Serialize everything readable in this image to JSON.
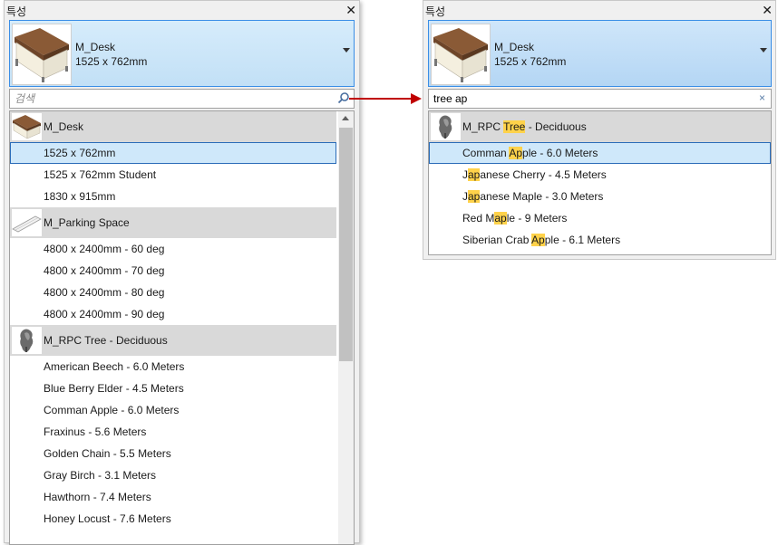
{
  "panel_title": "특성",
  "close_glyph": "✕",
  "left": {
    "type_selector": {
      "name": "M_Desk",
      "size": "1525 x 762mm"
    },
    "search": {
      "placeholder": "검색",
      "value": ""
    },
    "groups": [
      {
        "label": "M_Desk",
        "thumb": "desk",
        "items": [
          {
            "label": "1525 x 762mm",
            "selected": true
          },
          {
            "label": "1525 x 762mm Student"
          },
          {
            "label": "1830 x 915mm"
          }
        ]
      },
      {
        "label": "M_Parking Space",
        "thumb": "parking",
        "items": [
          {
            "label": "4800 x 2400mm - 60 deg"
          },
          {
            "label": "4800 x 2400mm - 70 deg"
          },
          {
            "label": "4800 x 2400mm - 80 deg"
          },
          {
            "label": "4800 x 2400mm - 90 deg"
          }
        ]
      },
      {
        "label": "M_RPC Tree - Deciduous",
        "thumb": "tree",
        "items": [
          {
            "label": "American Beech - 6.0 Meters"
          },
          {
            "label": "Blue Berry Elder - 4.5 Meters"
          },
          {
            "label": "Comman Apple - 6.0 Meters"
          },
          {
            "label": "Fraxinus - 5.6 Meters"
          },
          {
            "label": "Golden Chain - 5.5 Meters"
          },
          {
            "label": "Gray Birch - 3.1 Meters"
          },
          {
            "label": "Hawthorn - 7.4 Meters"
          },
          {
            "label": "Honey Locust - 7.6 Meters"
          }
        ]
      }
    ]
  },
  "right": {
    "type_selector": {
      "name": "M_Desk",
      "size": "1525 x 762mm"
    },
    "search": {
      "value": "tree ap",
      "clear_glyph": "×"
    },
    "groups": [
      {
        "label": "M_RPC Tree - Deciduous",
        "highlight": "Tree",
        "thumb": "tree",
        "items": [
          {
            "label": "Comman Apple - 6.0 Meters",
            "highlight": "Ap",
            "selected": true
          },
          {
            "label": "Japanese Cherry - 4.5 Meters",
            "highlight": "ap"
          },
          {
            "label": "Japanese Maple - 3.0 Meters",
            "highlight": "ap"
          },
          {
            "label": "Red Maple - 9 Meters",
            "highlight": "ap"
          },
          {
            "label": "Siberian Crab Apple - 6.1 Meters",
            "highlight": "Ap"
          }
        ]
      }
    ]
  },
  "colors": {
    "accent_blue": "#3a8ee6",
    "selection_fill": "#cfe8fa",
    "group_header": "#d9d9d9",
    "match_highlight": "#ffd24a",
    "arrow_red": "#c00000"
  }
}
